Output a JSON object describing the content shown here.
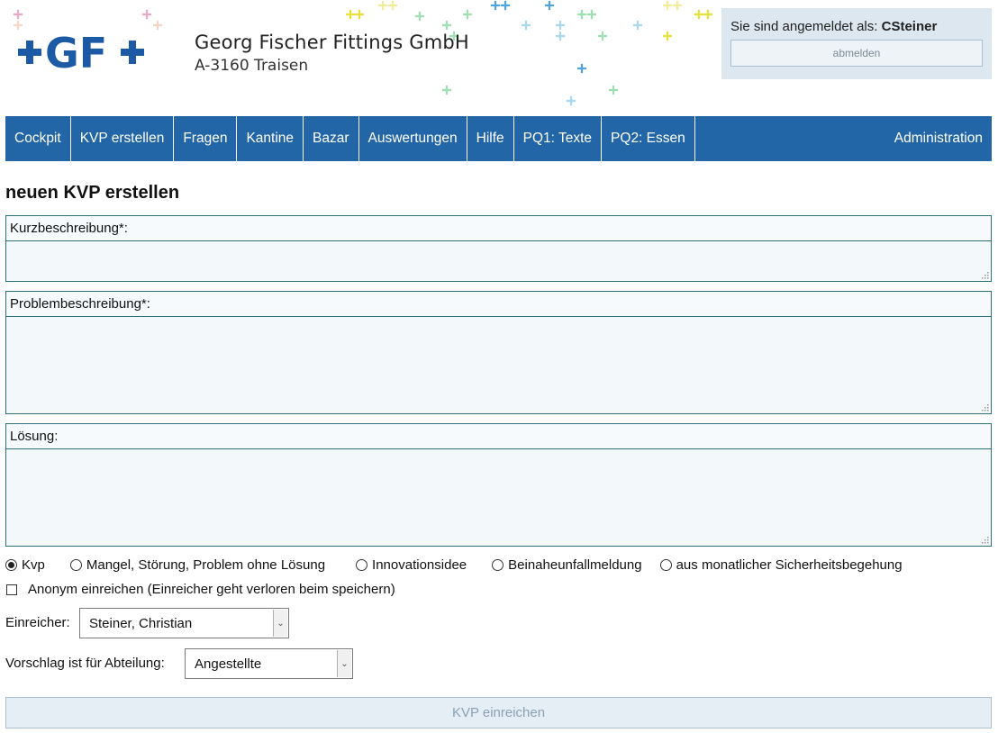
{
  "header": {
    "logo_text": "+GF+",
    "company_name": "Georg Fischer Fittings GmbH",
    "company_address": "A-3160 Traisen",
    "login_prefix": "Sie sind angemeldet als:",
    "login_user": "CSteiner",
    "logout_label": "abmelden"
  },
  "nav": {
    "items": [
      "Cockpit",
      "KVP erstellen",
      "Fragen",
      "Kantine",
      "Bazar",
      "Auswertungen",
      "Hilfe",
      "PQ1: Texte",
      "PQ2: Essen"
    ],
    "admin": "Administration"
  },
  "form": {
    "title": "neuen KVP erstellen",
    "short_label": "Kurzbeschreibung*:",
    "problem_label": "Problembeschreibung*:",
    "solution_label": "Lösung:",
    "types": [
      "Kvp",
      "Mangel, Störung, Problem ohne Lösung",
      "Innovationsidee",
      "Beinaheunfallmeldung",
      "aus monatlicher Sicherheitsbegehung"
    ],
    "selected_type": "Kvp",
    "anonymous_label": "Anonym einreichen (Einreicher geht verloren beim speichern)",
    "anonymous_checked": false,
    "submitter_label": "Einreicher:",
    "submitter_value": "Steiner, Christian",
    "department_label": "Vorschlag ist für Abteilung:",
    "department_value": "Angestellte",
    "submit_label": "KVP einreichen"
  },
  "colors": {
    "brand_blue": "#2266a7",
    "field_border": "#2c6f7a",
    "login_box_bg": "#dde7f0"
  }
}
